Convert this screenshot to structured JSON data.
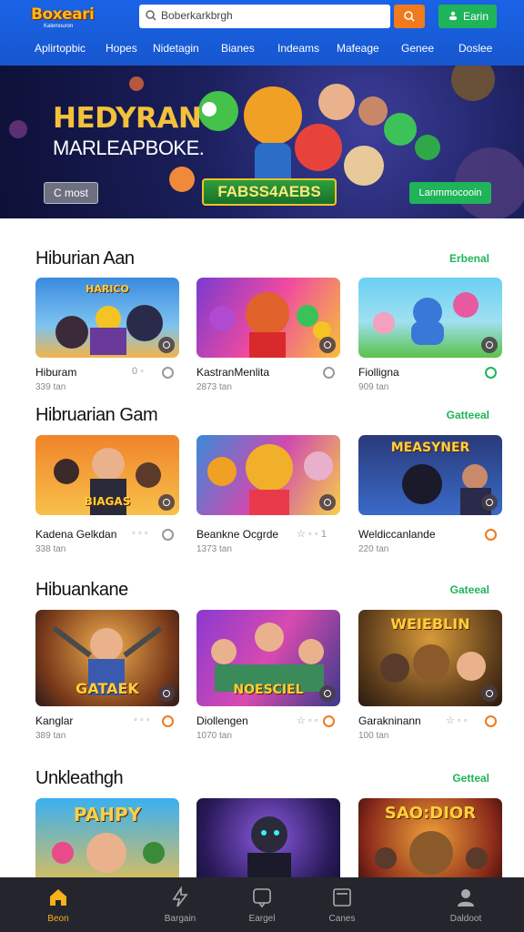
{
  "header": {
    "logo_text": "Boxeari",
    "logo_sub": "Kalemouron",
    "search_placeholder": "Boberkarkbrgh",
    "login_label": "Earin"
  },
  "nav": {
    "items": [
      "Aplirtopbic",
      "Hopes",
      "Nidetagin",
      "Bianes",
      "Indeams",
      "Mafeage",
      "Genee",
      "Doslee"
    ]
  },
  "hero": {
    "title1": "HEDYRAN",
    "title2": "MARLEAPBOKE.",
    "cta_label": "C most",
    "game_logo": "FABSS4AEBS",
    "cta2_label": "Lanmmocooin"
  },
  "sections": [
    {
      "title": "Hiburian Aan",
      "more": "Erbenal",
      "cards": [
        {
          "label": "HARICO",
          "name": "Hiburam",
          "meta": "339 tan"
        },
        {
          "label": "",
          "name": "KastranMenlita",
          "meta": "2873 tan"
        },
        {
          "label": "",
          "name": "Fiolligna",
          "meta": "909 tan"
        }
      ]
    },
    {
      "title": "Hibruarian Gam",
      "more": "Gatteeal",
      "cards": [
        {
          "label": "BIAGAS",
          "name": "Kadena Gelkdan",
          "meta": "338 tan"
        },
        {
          "label": "",
          "name": "Beankne Ocgrde",
          "meta": "1373 tan"
        },
        {
          "label": "MEASYNER",
          "name": "Weldiccanlande",
          "meta": "220 tan"
        }
      ]
    },
    {
      "title": "Hibuankane",
      "more": "Gateeal",
      "cards": [
        {
          "label": "GATAEK",
          "name": "Kanglar",
          "meta": "389 tan"
        },
        {
          "label": "NOESCIEL",
          "name": "Diollengen",
          "meta": "1070 tan"
        },
        {
          "label": "WEIEBLIN",
          "name": "Garakninann",
          "meta": "100 tan"
        }
      ]
    },
    {
      "title": "Unkleathgh",
      "more": "Getteal",
      "cards": [
        {
          "label": "PAHPY",
          "name": "",
          "meta": ""
        },
        {
          "label": "",
          "name": "",
          "meta": ""
        },
        {
          "label": "SAO:DIOR",
          "name": "",
          "meta": ""
        }
      ]
    }
  ],
  "card_dots": [
    "0 ◦",
    "◦ ◦ ◦",
    "◦ ◦ ◦",
    "☆ ◦ ◦",
    "☆ ◦ ◦"
  ],
  "card_star_dots": "☆ ◦ ◦ 1",
  "bottom_nav": [
    {
      "label": "Beon",
      "icon": "home-icon",
      "active": true
    },
    {
      "label": "Bargain",
      "icon": "lightning-icon"
    },
    {
      "label": "Eargel",
      "icon": "chat-icon"
    },
    {
      "label": "Canes",
      "icon": "tablet-icon"
    },
    {
      "label": "Daldoot",
      "icon": "profile-icon"
    }
  ],
  "colors": {
    "header": "#1a63e6",
    "accent_orange": "#f07a1c",
    "accent_green": "#1fb45a",
    "bottom_bar": "#25262d",
    "active_nav": "#f6b21a"
  }
}
